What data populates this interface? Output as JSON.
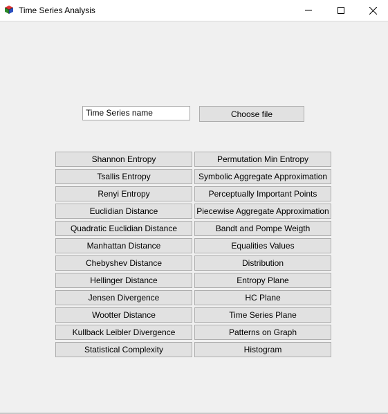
{
  "window": {
    "title": "Time Series Analysis",
    "icon": "app-cube-icon",
    "controls": [
      "minimize-icon",
      "maximize-icon",
      "close-icon"
    ]
  },
  "file_input": {
    "value": "Time Series name",
    "choose_label": "Choose file"
  },
  "left_column": [
    "Shannon Entropy",
    "Tsallis Entropy",
    "Renyi Entropy",
    "Euclidian Distance",
    "Quadratic Euclidian Distance",
    "Manhattan Distance",
    "Chebyshev Distance",
    "Hellinger Distance",
    "Jensen Divergence",
    "Wootter Distance",
    "Kullback Leibler Divergence",
    "Statistical Complexity"
  ],
  "right_column": [
    "Permutation Min Entropy",
    "Symbolic Aggregate Approximation",
    "Perceptually Important Points",
    "Piecewise Aggregate Approximation",
    "Bandt and Pompe Weigth",
    "Equalities Values",
    "Distribution",
    "Entropy Plane",
    "HC Plane",
    "Time Series Plane",
    "Patterns on Graph",
    "Histogram"
  ]
}
